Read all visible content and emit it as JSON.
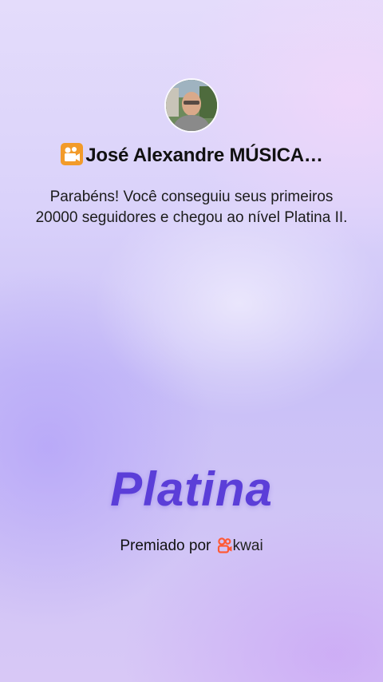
{
  "profile": {
    "avatar_icon": "user-avatar-photo",
    "title_icon": "movie-camera-icon",
    "name": "José Alexandre MÚSICA…"
  },
  "message": {
    "text": "Parabéns! Você conseguiu seus primeiros 20000 seguidores e chegou ao nível Platina II."
  },
  "level": {
    "name": "Platina"
  },
  "award": {
    "prefix": "Premiado por",
    "brand": "kwai",
    "brand_icon": "kwai-logo-icon"
  },
  "colors": {
    "accent": "#5b3ed8",
    "brand": "#ff5a36",
    "title_icon_bg": "#f29b2a"
  }
}
